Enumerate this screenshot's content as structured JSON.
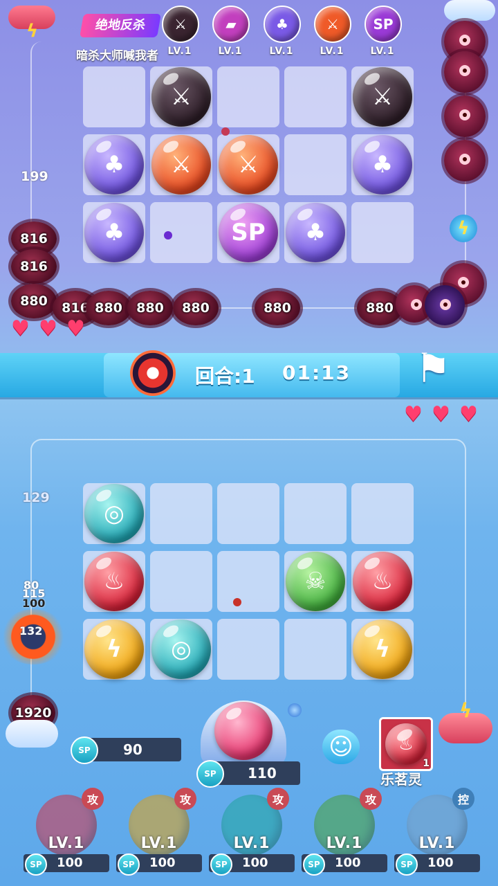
{
  "opponent": {
    "name": "暗杀大师喊我者",
    "title_badge": "绝地反杀",
    "skills": [
      {
        "label": "LV.1",
        "icon": "crossed-swords-icon",
        "color": "#3a2430"
      },
      {
        "label": "LV.1",
        "icon": "pink-card-icon",
        "color": "#c23fbe"
      },
      {
        "label": "LV.1",
        "icon": "clover-icon",
        "color": "#7a5ae6"
      },
      {
        "label": "LV.1",
        "icon": "sword-arrows-icon",
        "color": "#ef5a28"
      },
      {
        "label": "LV.1",
        "icon_text": "SP",
        "color": "#9a3ad6"
      }
    ],
    "side_number": "199",
    "hearts": 3
  },
  "enemy_numbers": [
    "816",
    "816",
    "880",
    "816",
    "880",
    "880",
    "880",
    "880",
    "880"
  ],
  "banner": {
    "round_label": "回合:1",
    "timer": "01:13"
  },
  "player": {
    "side_number": "129",
    "hearts": 3,
    "damage_numbers": [
      "80",
      "115",
      "100",
      "132"
    ],
    "boss_hp": "1920",
    "sp_left": "90",
    "sp_center": "110",
    "sp_badge": "SP",
    "next_character": {
      "name": "乐茗灵",
      "count": "1"
    },
    "skills": [
      {
        "label": "LV.1",
        "tag": "攻",
        "sp": "100",
        "color": "#d8354a",
        "tag_color": "#c94a55"
      },
      {
        "label": "LV.1",
        "tag": "攻",
        "sp": "100",
        "color": "#e6a414",
        "tag_color": "#c94a55"
      },
      {
        "label": "LV.1",
        "tag": "攻",
        "sp": "100",
        "color": "#21a7a0",
        "tag_color": "#c94a55"
      },
      {
        "label": "LV.1",
        "tag": "攻",
        "sp": "100",
        "color": "#4da53a",
        "tag_color": "#c94a55"
      },
      {
        "label": "LV.1",
        "tag": "控",
        "sp": "100",
        "color": "#7aa3c8",
        "tag_color": "#3f7fb8"
      }
    ]
  },
  "icons": {
    "swords": "⚔",
    "clover": "♣",
    "sp": "SP",
    "flame": "♨",
    "swirl": "◎",
    "bolt": "ϟ",
    "skull": "☠",
    "flag": "⚑",
    "smile": "☺",
    "heart": "♥"
  }
}
